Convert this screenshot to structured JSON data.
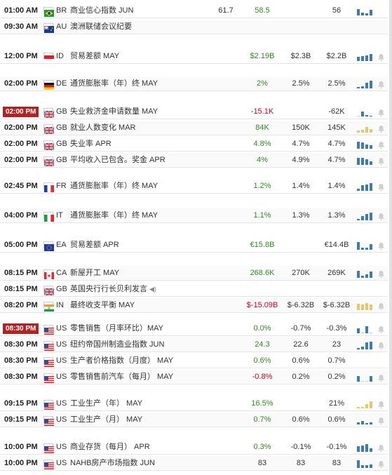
{
  "colors": {
    "up": "#2e8b22",
    "down": "#d0021b",
    "bar": "#3d7ab8",
    "bar_light": "#b9d0ea",
    "bar_yellow": "#e8c76b",
    "highlight": "#b22222"
  },
  "rows": [
    {
      "time": "01:00 AM",
      "flag": "br",
      "code": "BR",
      "event": "商业信心指数 JUN",
      "actual_extra": "61.7",
      "actual": "58.5",
      "forecast": "",
      "previous": "56",
      "dir": "up",
      "hist": [
        9,
        4,
        3,
        8
      ],
      "hist_color": "bar",
      "bell": false
    },
    {
      "time": "09:30 AM",
      "flag": "au",
      "code": "AU",
      "event": "澳洲联储会议纪要",
      "actual": "",
      "forecast": "",
      "previous": "",
      "dir": "neutral",
      "hist": [],
      "bell": false
    },
    {
      "time": "12:00 PM",
      "flag": "id",
      "code": "ID",
      "event": "贸易差额 MAY",
      "actual": "$2.19B",
      "forecast": "$2.3B",
      "previous": "$2.2B",
      "dir": "up",
      "hist": [
        6,
        7,
        8,
        10
      ],
      "hist_color": "bar",
      "bell": true
    },
    {
      "time": "02:00 PM",
      "flag": "de",
      "code": "DE",
      "event": "通货膨胀率（年）终 MAY",
      "actual": "2%",
      "forecast": "2.5%",
      "previous": "2.5%",
      "dir": "up",
      "hist": [
        2,
        3,
        8,
        11
      ],
      "hist_color": "bar",
      "bell": true
    },
    {
      "time": "02:00 PM",
      "flag": "gb",
      "code": "GB",
      "event": "失业救济金申请数量 MAY",
      "actual": "-15.1K",
      "forecast": "",
      "previous": "-62K",
      "dir": "down",
      "hist": [
        0,
        7,
        2,
        1
      ],
      "hist_color": "bar",
      "bell": true,
      "highlight": true
    },
    {
      "time": "02:00 PM",
      "flag": "gb",
      "code": "GB",
      "event": "就业人数变化 MAR",
      "actual": "84K",
      "forecast": "150K",
      "previous": "145K",
      "dir": "up",
      "hist": [
        3,
        4,
        8,
        5
      ],
      "hist_color": "bar_yellow",
      "bell": true
    },
    {
      "time": "02:00 PM",
      "flag": "gb",
      "code": "GB",
      "event": "失业率 APR",
      "actual": "4.8%",
      "forecast": "4.7%",
      "previous": "4.7%",
      "dir": "up",
      "hist": [
        10,
        9,
        6,
        5
      ],
      "hist_color": "bar",
      "bell": true
    },
    {
      "time": "02:00 PM",
      "flag": "gb",
      "code": "GB",
      "event": "平均收入已包含。奖金 APR",
      "actual": "4%",
      "forecast": "4.9%",
      "previous": "4.7%",
      "dir": "up",
      "hist": [
        10,
        10,
        8,
        5
      ],
      "hist_color": "bar",
      "bell": true
    },
    {
      "time": "02:45 PM",
      "flag": "fr",
      "code": "FR",
      "event": "通货膨胀率（年）终 MAY",
      "actual": "1.2%",
      "forecast": "1.4%",
      "previous": "1.4%",
      "dir": "up",
      "hist": [
        3,
        8,
        9,
        11
      ],
      "hist_color": "bar",
      "bell": true
    },
    {
      "time": "04:00 PM",
      "flag": "it",
      "code": "IT",
      "event": "通货膨胀率（年）终 MAY",
      "actual": "1.1%",
      "forecast": "1.3%",
      "previous": "1.3%",
      "dir": "up",
      "hist": [
        2,
        6,
        9,
        11
      ],
      "hist_color": "bar",
      "bell": true
    },
    {
      "time": "05:00 PM",
      "flag": "ea",
      "code": "EA",
      "event": "贸易差额 APR",
      "actual": "€15.8B",
      "forecast": "",
      "previous": "€14.4B",
      "dir": "up",
      "hist": [
        11,
        3,
        3,
        8
      ],
      "hist_color": "bar",
      "bell": true
    },
    {
      "time": "08:15 PM",
      "flag": "ca",
      "code": "CA",
      "event": "新屋开工 MAY",
      "actual": "268.6K",
      "forecast": "270K",
      "previous": "269K",
      "dir": "up",
      "hist": [
        10,
        3,
        5,
        9
      ],
      "hist_color": "bar",
      "bell": true
    },
    {
      "time": "08:15 PM",
      "flag": "gb",
      "code": "GB",
      "event": "英国央行行长贝利发言",
      "speaker": "◀)",
      "actual": "",
      "forecast": "",
      "previous": "",
      "dir": "neutral",
      "hist": [],
      "bell": false
    },
    {
      "time": "08:20 PM",
      "flag": "in",
      "code": "IN",
      "event": "最终收支平衡 MAY",
      "actual": "$-15.09B",
      "forecast": "$-6.32B",
      "previous": "$-6.32B",
      "dir": "down",
      "hist": [
        9,
        8,
        10,
        8
      ],
      "hist_color": "bar_yellow",
      "bell": true
    },
    {
      "time": "08:30 PM",
      "flag": "us",
      "code": "US",
      "event": "零售销售（月率环比）MAY",
      "actual": "0.0%",
      "forecast": "-0.7%",
      "previous": "-0.3%",
      "dir": "up",
      "hist": [
        7,
        0,
        10,
        0
      ],
      "hist_color": "bar",
      "bell": true,
      "highlight": true
    },
    {
      "time": "08:30 PM",
      "flag": "us",
      "code": "US",
      "event": "纽约帝国州制造业指数 JUN",
      "actual": "24.3",
      "forecast": "22.6",
      "previous": "23",
      "dir": "up",
      "hist": [
        2,
        4,
        10,
        11
      ],
      "hist_color": "bar",
      "bell": true
    },
    {
      "time": "08:30 PM",
      "flag": "us",
      "code": "US",
      "event": "生产者价格指数（月度） MAY",
      "actual": "0.6%",
      "forecast": "0.6%",
      "previous": "0.7%",
      "dir": "up",
      "hist": [],
      "bell": false
    },
    {
      "time": "08:30 PM",
      "flag": "us",
      "code": "US",
      "event": "零售销售前汽车（每月） MAY",
      "actual": "-0.8%",
      "forecast": "0.2%",
      "previous": "0.2%",
      "dir": "down",
      "hist": [
        8,
        0,
        0,
        8
      ],
      "hist_color": "bar",
      "bell": true
    },
    {
      "time": "09:15 PM",
      "flag": "us",
      "code": "US",
      "event": "工业生产（年） MAY",
      "actual": "16.5%",
      "forecast": "",
      "previous": "21%",
      "dir": "up",
      "hist": [
        2,
        2,
        6,
        10
      ],
      "hist_color": "bar_yellow",
      "bell": true
    },
    {
      "time": "09:15 PM",
      "flag": "us",
      "code": "US",
      "event": "工业生产（月） MAY",
      "actual": "0.7%",
      "forecast": "0.6%",
      "previous": "0.6%",
      "dir": "up",
      "hist": [
        3,
        5,
        2,
        3
      ],
      "hist_color": "bar",
      "bell": true
    },
    {
      "time": "10:00 PM",
      "flag": "us",
      "code": "US",
      "event": "商业存货（每月） APR",
      "actual": "0.3%",
      "forecast": "-0.1%",
      "previous": "-0.1%",
      "dir": "up",
      "hist": [
        8,
        9,
        11,
        5
      ],
      "hist_color": "bar",
      "bell": true
    },
    {
      "time": "10:00 PM",
      "flag": "us",
      "code": "US",
      "event": "NAHB房产市场指数 JUN",
      "actual": "83",
      "forecast": "83",
      "previous": "83",
      "dir": "neutral",
      "hist": [
        11,
        4,
        4,
        5
      ],
      "hist_color": "bar",
      "bell": true
    }
  ]
}
